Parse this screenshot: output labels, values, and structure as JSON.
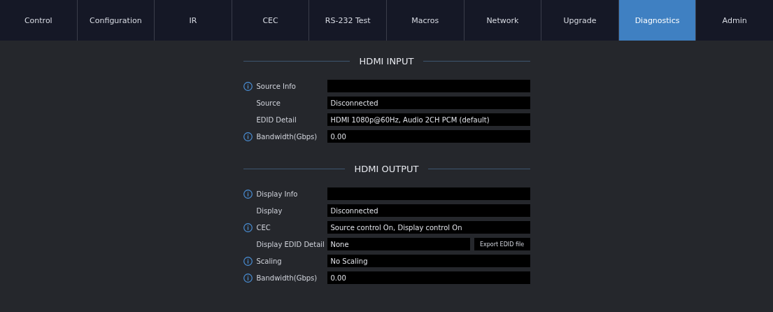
{
  "tabs": [
    {
      "label": "Control",
      "selected": false
    },
    {
      "label": "Configuration",
      "selected": false
    },
    {
      "label": "IR",
      "selected": false
    },
    {
      "label": "CEC",
      "selected": false
    },
    {
      "label": "RS-232 Test",
      "selected": false
    },
    {
      "label": "Macros",
      "selected": false
    },
    {
      "label": "Network",
      "selected": false
    },
    {
      "label": "Upgrade",
      "selected": false
    },
    {
      "label": "Diagnostics",
      "selected": true
    },
    {
      "label": "Admin",
      "selected": false
    }
  ],
  "sections": [
    {
      "title": "HDMI INPUT",
      "rows": [
        {
          "label": "Source Info",
          "info": true
        },
        {
          "label": "Source",
          "info": false,
          "value": "Disconnected"
        },
        {
          "label": "EDID Detail",
          "info": false,
          "value": "HDMI 1080p@60Hz, Audio 2CH PCM (default)"
        },
        {
          "label": "Bandwidth(Gbps)",
          "info": true,
          "value": "0.00"
        }
      ]
    },
    {
      "title": "HDMI OUTPUT",
      "rows": [
        {
          "label": "Display Info",
          "info": true
        },
        {
          "label": "Display",
          "info": false,
          "value": "Disconnected"
        },
        {
          "label": "CEC",
          "info": true,
          "value": "Source control On, Display control On"
        },
        {
          "label": "Display EDID Detail",
          "info": false,
          "value": "None",
          "button": "Export EDID file"
        },
        {
          "label": "Scaling",
          "info": true,
          "value": "No Scaling"
        },
        {
          "label": "Bandwidth(Gbps)",
          "info": true,
          "value": "0.00"
        }
      ]
    }
  ]
}
